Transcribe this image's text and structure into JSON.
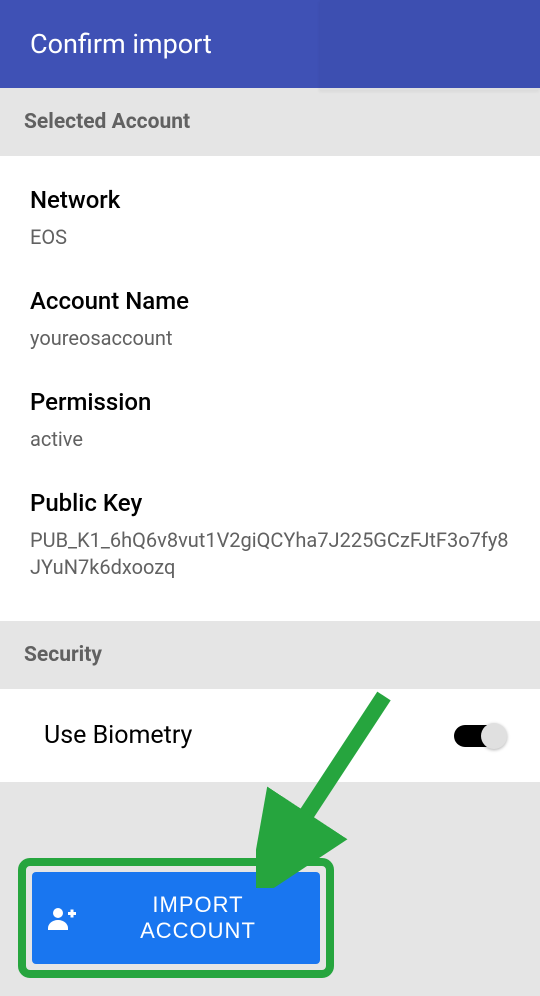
{
  "header": {
    "title": "Confirm import"
  },
  "sections": {
    "account": {
      "heading": "Selected Account",
      "fields": {
        "network": {
          "label": "Network",
          "value": "EOS"
        },
        "accountName": {
          "label": "Account Name",
          "value": "youreosaccount"
        },
        "permission": {
          "label": "Permission",
          "value": "active"
        },
        "publicKey": {
          "label": "Public Key",
          "value": "PUB_K1_6hQ6v8vut1V2giQCYha7J225GCzFJtF3o7fy8JYuN7k6dxoozq"
        }
      }
    },
    "security": {
      "heading": "Security",
      "biometry": {
        "label": "Use Biometry",
        "enabled": true
      }
    }
  },
  "actions": {
    "importLabel": "IMPORT ACCOUNT"
  },
  "colors": {
    "primary": "#3f51b5",
    "buttonBlue": "#1976f0",
    "highlightGreen": "#26a53e"
  }
}
